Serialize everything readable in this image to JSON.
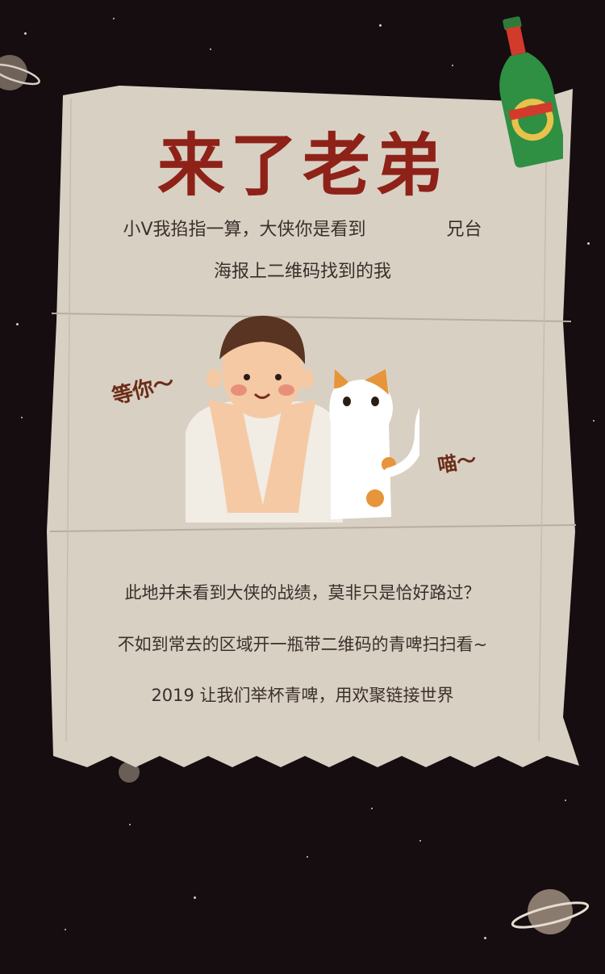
{
  "title": "来了老弟",
  "intro": {
    "line1_part1": "小V我掐指一算，大侠你是看到",
    "line1_part2": "兄台",
    "line2": "海报上二维码找到的我"
  },
  "illustration": {
    "bubble_wait": "等你～",
    "bubble_meow": "喵～"
  },
  "message": {
    "line1": "此地并未看到大侠的战绩，莫非只是恰好路过？",
    "line2": "不如到常去的区域开一瓶带二维码的青啤扫扫看~",
    "line3": "2019 让我们举杯青啤，用欢聚链接世界"
  },
  "colors": {
    "background": "#150d0f",
    "paper": "#d9d0c4",
    "title": "#8e2218",
    "text": "#3b2f2a"
  }
}
